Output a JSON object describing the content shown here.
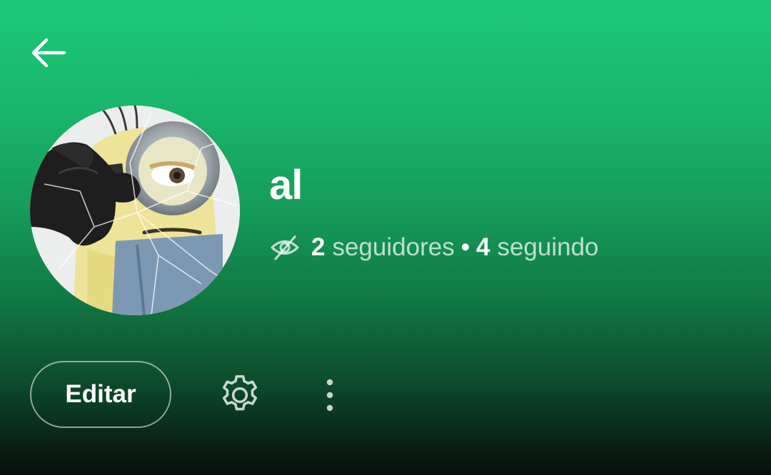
{
  "header": {
    "back_icon": "arrow-left-icon"
  },
  "profile": {
    "avatar": "minion-avatar-image",
    "name": "al",
    "privacy_icon": "eye-off-icon",
    "followers_count": "2",
    "followers_label": "seguidores",
    "separator": "•",
    "following_count": "4",
    "following_label": "seguindo"
  },
  "actions": {
    "edit_label": "Editar",
    "settings_icon": "gear-icon",
    "more_icon": "more-vertical-icon"
  },
  "colors": {
    "gradient_top": "#1ec97a",
    "gradient_bottom": "#0a0f0c",
    "text_primary": "#ffffff",
    "text_secondary": "#b8d8c6"
  }
}
